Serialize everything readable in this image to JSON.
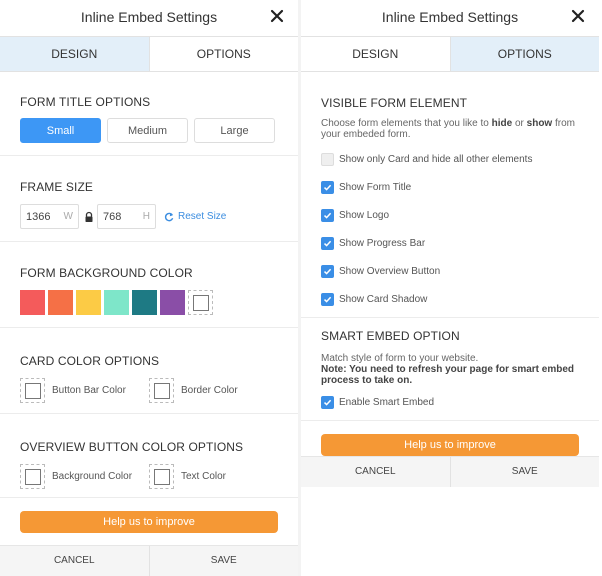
{
  "dialog": {
    "title": "Inline Embed Settings",
    "tabs": {
      "design": "DESIGN",
      "options": "OPTIONS"
    },
    "improve_label": "Help us to improve",
    "cancel_label": "CANCEL",
    "save_label": "SAVE"
  },
  "design": {
    "form_title": {
      "heading": "FORM TITLE OPTIONS",
      "sizes": [
        "Small",
        "Medium",
        "Large"
      ],
      "selected": "Small"
    },
    "frame_size": {
      "heading": "FRAME SIZE",
      "width": "1366",
      "width_unit": "W",
      "height": "768",
      "height_unit": "H",
      "reset_label": "Reset Size"
    },
    "background": {
      "heading": "FORM BACKGROUND COLOR",
      "colors": [
        "#f45b5b",
        "#f57046",
        "#fccb45",
        "#7ee6c9",
        "#1e7a84",
        "#8a4ea7"
      ]
    },
    "card_color": {
      "heading": "CARD COLOR OPTIONS",
      "button_bar": "Button Bar Color",
      "border": "Border Color"
    },
    "overview_color": {
      "heading": "OVERVIEW BUTTON COLOR OPTIONS",
      "background": "Background Color",
      "text": "Text Color"
    }
  },
  "options": {
    "visible": {
      "heading": "VISIBLE FORM ELEMENT",
      "desc_pre": "Choose form elements that you like to ",
      "desc_hide": "hide",
      "desc_mid": " or ",
      "desc_show": "show",
      "desc_post": " from your embeded form.",
      "items": [
        {
          "label": "Show only Card and hide all other elements",
          "checked": false
        },
        {
          "label": "Show Form Title",
          "checked": true
        },
        {
          "label": "Show Logo",
          "checked": true
        },
        {
          "label": "Show Progress Bar",
          "checked": true
        },
        {
          "label": "Show Overview Button",
          "checked": true
        },
        {
          "label": "Show Card Shadow",
          "checked": true
        }
      ]
    },
    "smart": {
      "heading": "SMART EMBED OPTION",
      "desc": "Match style of form to your website.",
      "note": "Note: You need to refresh your page for smart embed process to take on.",
      "enable_label": "Enable Smart Embed",
      "enabled": true
    }
  },
  "colors": {
    "accent": "#3d97f5",
    "improve": "#f59835",
    "check": "#3a8ee6"
  }
}
